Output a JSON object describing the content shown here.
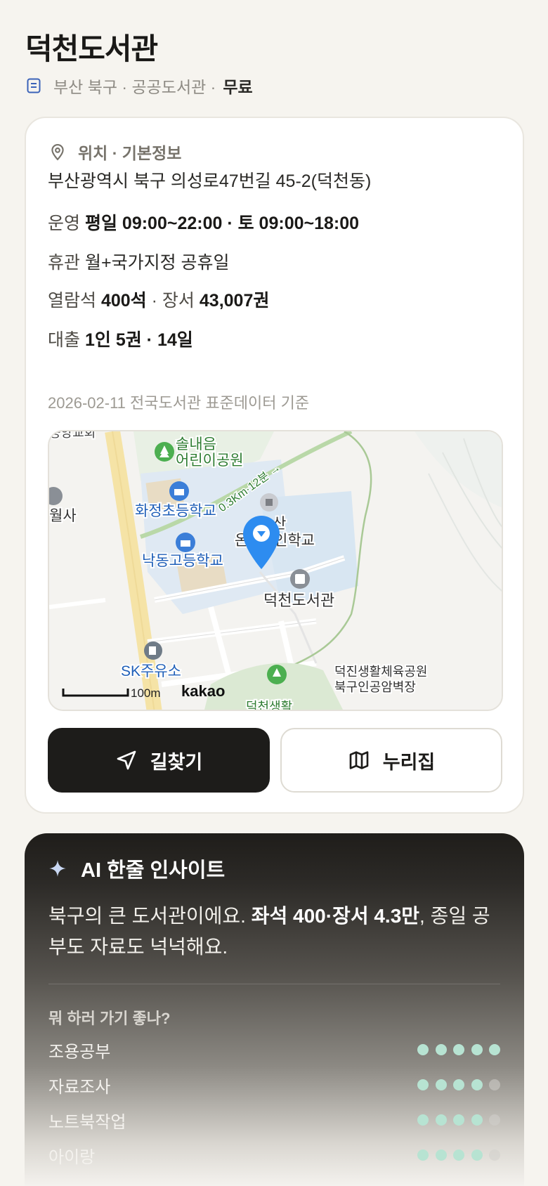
{
  "library": {
    "name": "덕천도서관",
    "meta_prefix": "부산 북구 · 공공도서관 ·",
    "price": "무료"
  },
  "info": {
    "section_title": "위치 · 기본정보",
    "address": "부산광역시 북구 의성로47번길 45-2(덕천동)",
    "hours_label": "운영",
    "hours_value": "평일 09:00~22:00 · 토 09:00~18:00",
    "closed_label": "휴관",
    "closed_value": "월+국가지정 공휴일",
    "seats_label": "열람석",
    "seats_value": "400석",
    "books_label": "장서",
    "books_value": "43,007권",
    "loan_label": "대출",
    "loan_value": "1인 5권 · 14일",
    "as_of": "2026-02-11 전국도서관 표준데이터 기준"
  },
  "map": {
    "labels": {
      "park_top_1": "솔내음",
      "park_top_2": "어린이공원",
      "school_1": "화정초등학교",
      "school_2": "낙동고등학교",
      "school_3_left": "온",
      "school_3_right": "산",
      "school_3_rest": "인학교",
      "temple": "월사",
      "library": "덕천도서관",
      "gas_station": "SK주유소",
      "sports_park": "덕진생활체육공원",
      "rock_art": "북구인공암벽장",
      "church": "중앙교회",
      "walk_route": "0.3Km·12분 →",
      "scale": "100m",
      "provider": "kakao",
      "bottom_partial": "덕천생활"
    }
  },
  "buttons": {
    "directions": "길찾기",
    "website": "누리집"
  },
  "ai": {
    "title": "AI 한줄 인사이트",
    "text_1": "북구의 큰 도서관이에요. ",
    "text_bold": "좌석 400·장서 4.3만",
    "text_2": ", 종일 공부도 자료도 넉넉해요.",
    "question": "뭐 하러 가기 좋나?",
    "purposes": [
      {
        "label": "조용공부",
        "score": 5,
        "max": 5
      },
      {
        "label": "자료조사",
        "score": 4,
        "max": 5
      },
      {
        "label": "노트북작업",
        "score": 4,
        "max": 5
      },
      {
        "label": "아이랑",
        "score": 4,
        "max": 5
      }
    ]
  },
  "colors": {
    "accent_blue": "#2d8cf0",
    "dot_on": "#b7e3d2",
    "dark_button": "#1d1c1a"
  }
}
